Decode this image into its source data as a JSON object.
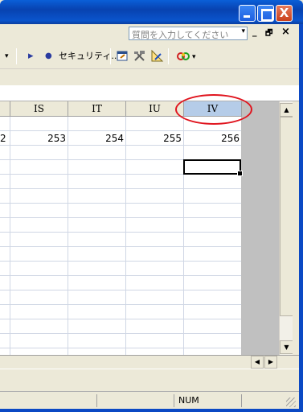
{
  "window": {
    "minimize_icon": "minimize-icon",
    "maximize_icon": "maximize-icon",
    "close_glyph": "X"
  },
  "menubar": {
    "help_placeholder": "質問を入力してください",
    "help_dropdown_glyph": "▾",
    "doc_min_glyph": "_",
    "doc_restore_glyph": "🗗",
    "doc_close_glyph": "×"
  },
  "toolbar": {
    "dropdown_glyph": "▾",
    "play_glyph": "▸",
    "bullet_glyph": "●",
    "security_label": "セキュリティ...",
    "more_glyph": "▾"
  },
  "grid": {
    "columns": [
      {
        "label": ""
      },
      {
        "label": "IS"
      },
      {
        "label": "IT"
      },
      {
        "label": "IU"
      },
      {
        "label": "IV"
      }
    ],
    "selected_column": "IV",
    "first_row": [
      "2",
      "253",
      "254",
      "255",
      "256"
    ]
  },
  "scroll": {
    "up": "▲",
    "down": "▼",
    "left": "◀",
    "right": "▶"
  },
  "status": {
    "num": "NUM"
  },
  "colors": {
    "titlebar": "#0a54cc",
    "annotation": "#e0141e",
    "selected_header": "#b5cce8"
  }
}
